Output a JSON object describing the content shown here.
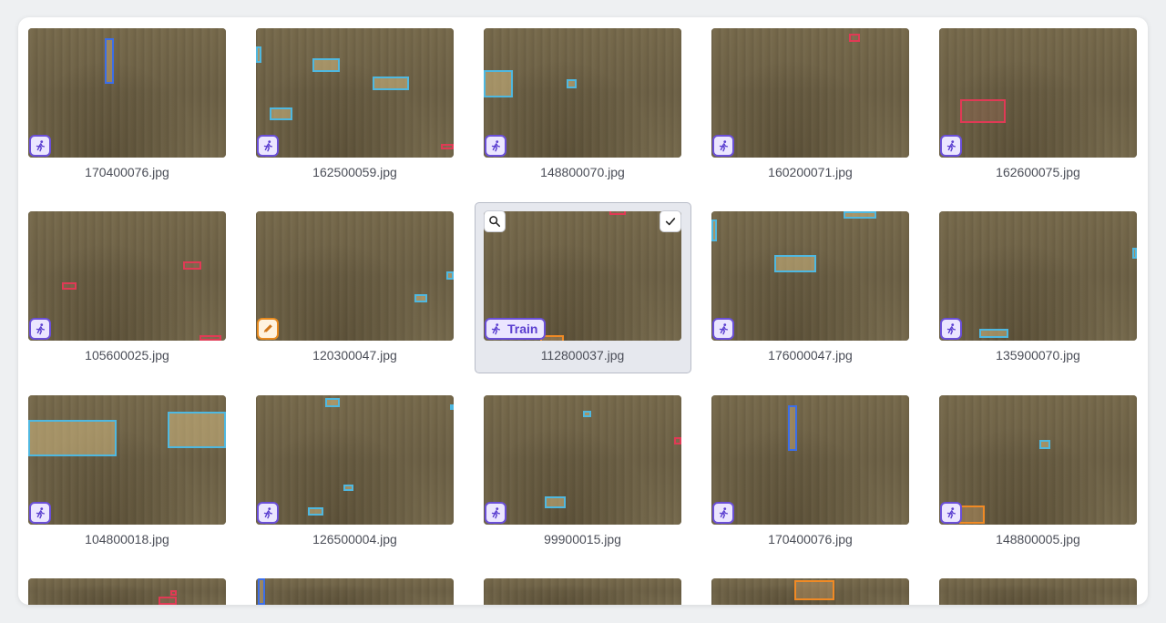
{
  "gallery": {
    "items": [
      {
        "filename": "170400076.jpg",
        "tag": "train"
      },
      {
        "filename": "162500059.jpg",
        "tag": "train"
      },
      {
        "filename": "148800070.jpg",
        "tag": "train"
      },
      {
        "filename": "160200071.jpg",
        "tag": "train"
      },
      {
        "filename": "162600075.jpg",
        "tag": "train"
      },
      {
        "filename": "105600025.jpg",
        "tag": "train"
      },
      {
        "filename": "120300047.jpg",
        "tag": "edit"
      },
      {
        "filename": "112800037.jpg",
        "tag": "train",
        "tag_label": "Train",
        "selected": true
      },
      {
        "filename": "176000047.jpg",
        "tag": "train"
      },
      {
        "filename": "135900070.jpg",
        "tag": "train"
      },
      {
        "filename": "104800018.jpg",
        "tag": "train"
      },
      {
        "filename": "126500004.jpg",
        "tag": "train"
      },
      {
        "filename": "99900015.jpg",
        "tag": "train"
      },
      {
        "filename": "170400076.jpg",
        "tag": "train"
      },
      {
        "filename": "148800005.jpg",
        "tag": "train"
      }
    ]
  },
  "icons": {
    "train": "person-running-icon",
    "edit": "pencil-icon",
    "search": "search-icon",
    "check": "check-icon"
  },
  "colors": {
    "train_badge": "#6a4fd8",
    "edit_badge": "#e88a1e",
    "bbox_cyan": "#4fb8e0",
    "bbox_red": "#e03a55",
    "bbox_orange": "#f08a25",
    "bbox_blue": "#3c6ee8"
  }
}
